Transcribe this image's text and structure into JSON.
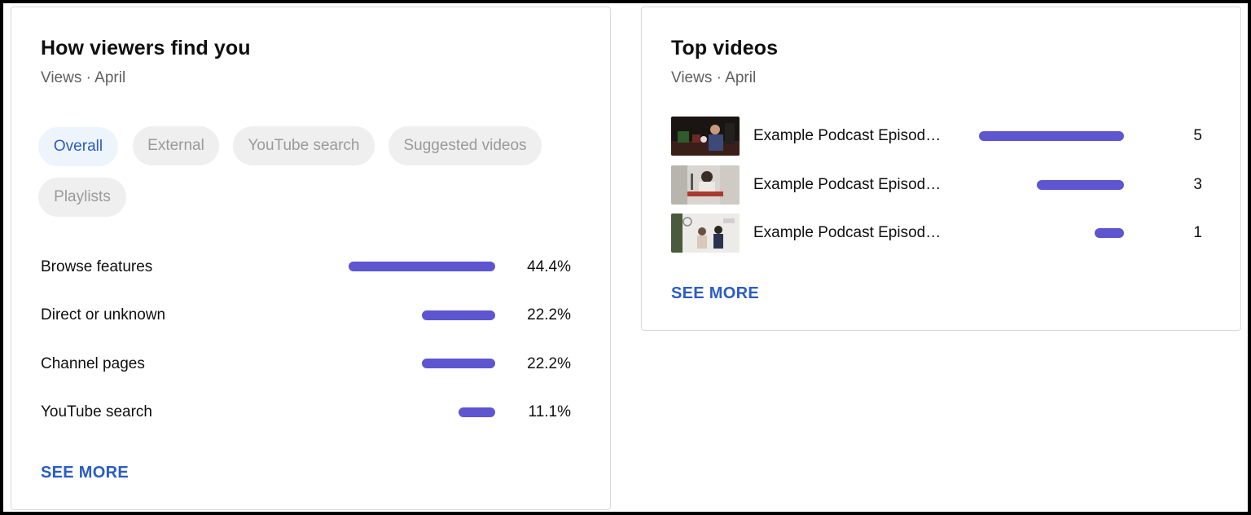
{
  "colors": {
    "bar": "#5e55d1",
    "link": "#2a5cc6",
    "chip_active_bg": "#eef4fb",
    "chip_bg": "#efefef"
  },
  "traffic": {
    "title": "How viewers find you",
    "subtitle": "Views · April",
    "chips": [
      {
        "label": "Overall",
        "active": true
      },
      {
        "label": "External",
        "active": false
      },
      {
        "label": "YouTube search",
        "active": false
      },
      {
        "label": "Suggested videos",
        "active": false
      },
      {
        "label": "Playlists",
        "active": false
      }
    ],
    "rows": [
      {
        "label": "Browse features",
        "value": "44.4%",
        "fraction": 1.0
      },
      {
        "label": "Direct or unknown",
        "value": "22.2%",
        "fraction": 0.5
      },
      {
        "label": "Channel pages",
        "value": "22.2%",
        "fraction": 0.5
      },
      {
        "label": "YouTube search",
        "value": "11.1%",
        "fraction": 0.25
      }
    ],
    "see_more": "SEE MORE"
  },
  "top_videos": {
    "title": "Top videos",
    "subtitle": "Views · April",
    "videos": [
      {
        "title": "Example Podcast Episod…",
        "views": "5",
        "fraction": 1.0,
        "thumb": "thumbnail-dark-studio"
      },
      {
        "title": "Example Podcast Episod…",
        "views": "3",
        "fraction": 0.6,
        "thumb": "thumbnail-light-desk"
      },
      {
        "title": "Example Podcast Episod…",
        "views": "1",
        "fraction": 0.2,
        "thumb": "thumbnail-white-room"
      }
    ],
    "see_more": "SEE MORE"
  }
}
